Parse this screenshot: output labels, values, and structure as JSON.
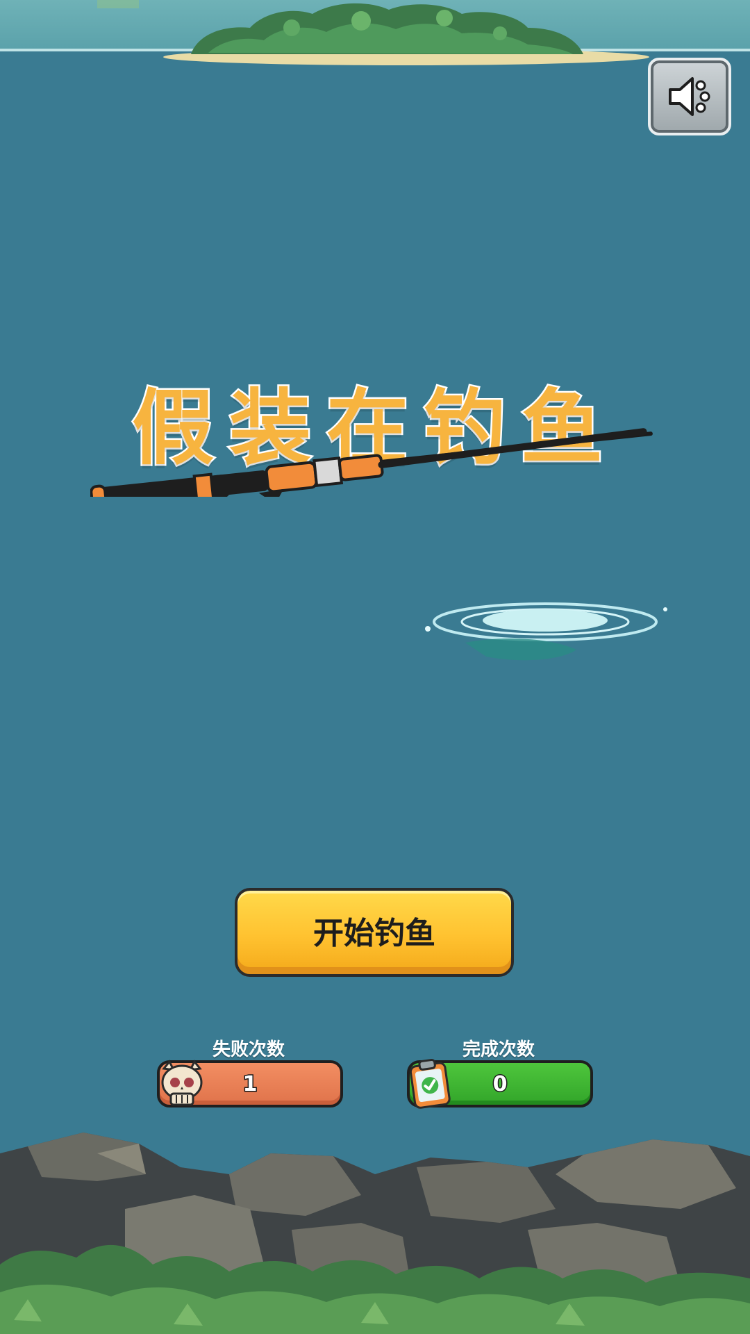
{
  "title": "假装在钓鱼",
  "start_button": {
    "label": "开始钓鱼"
  },
  "stats": {
    "fail": {
      "caption": "失败次数",
      "value": "1"
    },
    "done": {
      "caption": "完成次数",
      "value": "0"
    }
  },
  "icons": {
    "sound": "speaker-icon",
    "fail": "skull-icon",
    "done": "clipboard-check-icon"
  },
  "colors": {
    "sea": "#3a7b92",
    "title": "#f7b43f",
    "start_button": "#ffc230",
    "fail_bar": "#e0734b",
    "done_bar": "#32a52a"
  }
}
